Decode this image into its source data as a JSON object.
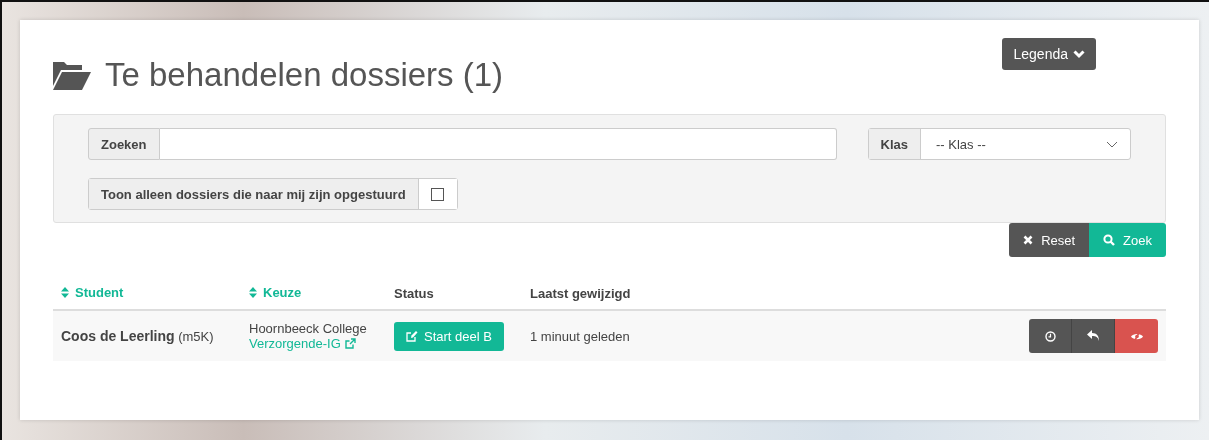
{
  "header": {
    "title": "Te behandelen dossiers (1)",
    "legend_button": "Legenda"
  },
  "filters": {
    "search": {
      "label": "Zoeken"
    },
    "class": {
      "label": "Klas",
      "value": "-- Klas --"
    },
    "only_sent_to_me": {
      "label": "Toon alleen dossiers die naar mij zijn opgestuurd",
      "checked": false
    },
    "reset_button": "Reset",
    "search_button": "Zoek"
  },
  "table": {
    "columns": [
      {
        "label": "Student",
        "sortable": true
      },
      {
        "label": "Keuze",
        "sortable": true
      },
      {
        "label": "Status",
        "sortable": false
      },
      {
        "label": "Laatst gewijzigd",
        "sortable": false
      }
    ],
    "rows": [
      {
        "student": "Coos de Leerling",
        "class": "(m5K)",
        "school": "Hoornbeeck College",
        "choice": "Verzorgende-IG",
        "status_button": "Start deel B",
        "modified": "1 minuut geleden"
      }
    ]
  }
}
